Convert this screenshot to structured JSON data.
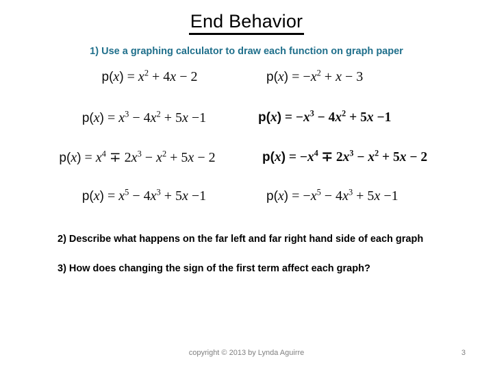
{
  "slide": {
    "title": "End Behavior",
    "accent_color": "#1f6f8b",
    "text_color": "#000000",
    "footer_color": "#7f7f7f",
    "background": "#ffffff"
  },
  "instructions": {
    "step1": "1) Use a graphing calculator to draw each function on graph paper",
    "step2": "2) Describe what happens on the far left and far right hand side of each graph",
    "step3": "3) How does changing the sign of the first term affect each graph?"
  },
  "equations": {
    "rows": [
      {
        "left": {
          "plain": "p(x) = x2 + 4x − 2",
          "terms": [
            "p(",
            "x",
            ") = ",
            "x",
            "2",
            " + 4",
            "x",
            " − 2"
          ]
        },
        "right": {
          "plain": "p(x) = −x2 + x − 3",
          "terms": [
            "p(",
            "x",
            ") = −",
            "x",
            "2",
            " + ",
            "x",
            " − 3"
          ]
        }
      },
      {
        "left": {
          "plain": "p(x) = x3 − 4x2 + 5x −1",
          "terms": [
            "p(",
            "x",
            ") = ",
            "x",
            "3",
            " − 4",
            "x",
            "2",
            " + 5",
            "x",
            " −1"
          ]
        },
        "right": {
          "plain": "p(x) = −x3 − 4x2 + 5x −1",
          "terms": [
            "p(",
            "x",
            ") = −",
            "x",
            "3",
            " − 4",
            "x",
            "2",
            " + 5",
            "x",
            " −1"
          ]
        }
      },
      {
        "left": {
          "plain": "p(x) = x4 ∓ 2x3 − x2 + 5x − 2",
          "terms": [
            "p(",
            "x",
            ") = ",
            "x",
            "4",
            " ∓ 2",
            "x",
            "3",
            " − ",
            "x",
            "2",
            " + 5",
            "x",
            " − 2"
          ]
        },
        "right": {
          "plain": "p(x) = −x4 ∓ 2x3 − x2 + 5x − 2",
          "terms": [
            "p(",
            "x",
            ") = −",
            "x",
            "4",
            " ∓ 2",
            "x",
            "3",
            " − ",
            "x",
            "2",
            " + 5",
            "x",
            " − 2"
          ]
        }
      },
      {
        "left": {
          "plain": "p(x) = x5 − 4x3 + 5x −1",
          "terms": [
            "p(",
            "x",
            ") = ",
            "x",
            "5",
            " − 4",
            "x",
            "3",
            " + 5",
            "x",
            " −1"
          ]
        },
        "right": {
          "plain": "p(x) = −x5 − 4x3 + 5x −1",
          "terms": [
            "p(",
            "x",
            ") = −",
            "x",
            "5",
            " − 4",
            "x",
            "3",
            " + 5",
            "x",
            " −1"
          ]
        }
      }
    ]
  },
  "footer": {
    "copyright": "copyright © 2013 by Lynda Aguirre",
    "page_number": "3"
  }
}
